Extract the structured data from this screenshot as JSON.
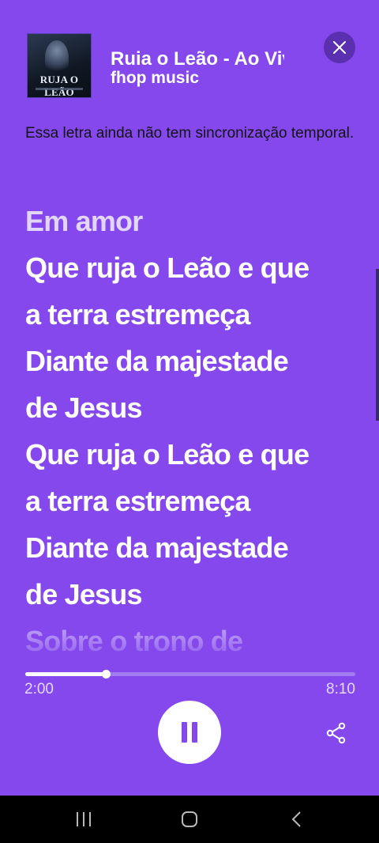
{
  "player": {
    "track_title": "Ruja o Leão - Ao Vivo",
    "artist": "fhop music",
    "cover_text": "RUJA O LEÃO",
    "background_color": "#8448ec"
  },
  "notice": "Essa letra ainda não tem sincronização temporal.",
  "lyrics": [
    "Em amor",
    "Que ruja o Leão e que",
    "a terra estremeça",
    "Diante da majestade",
    "de Jesus",
    "Que ruja o Leão e que",
    "a terra estremeça",
    "Diante da majestade",
    "de Jesus",
    "Sobre o trono de"
  ],
  "playback": {
    "elapsed": "2:00",
    "total": "8:10",
    "progress_fraction": 0.245
  },
  "icons": {
    "close": "close-icon",
    "pause": "pause-icon",
    "share": "share-icon",
    "recent_apps": "recent-apps-icon",
    "home": "home-icon",
    "back": "back-icon"
  }
}
